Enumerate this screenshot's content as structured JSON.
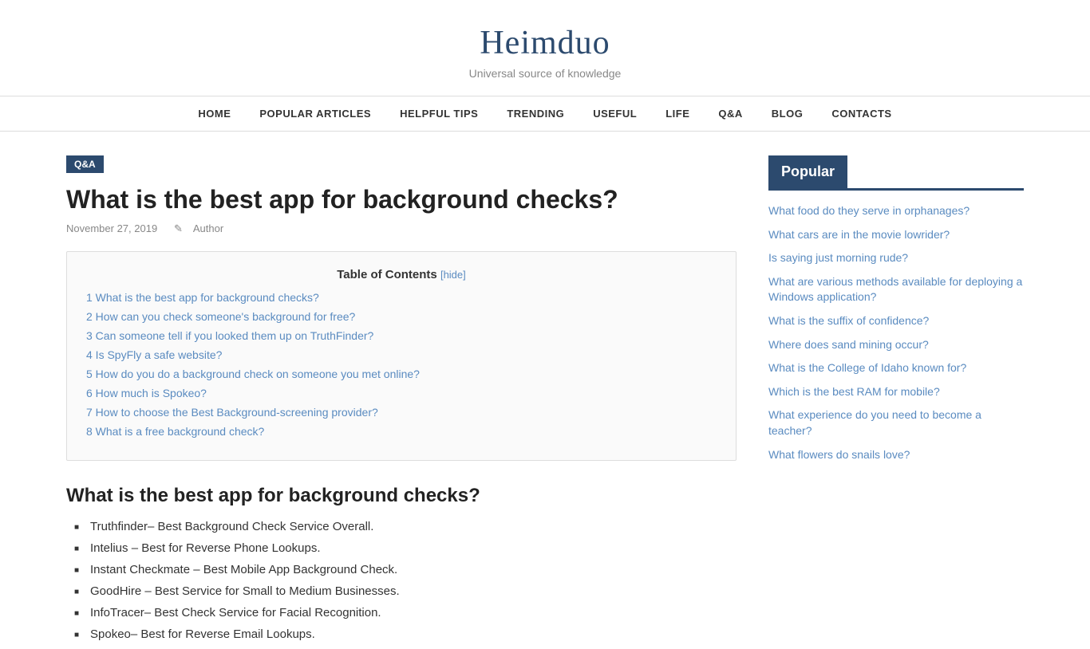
{
  "site": {
    "title": "Heimduo",
    "tagline": "Universal source of knowledge"
  },
  "nav": {
    "items": [
      {
        "label": "HOME",
        "href": "#"
      },
      {
        "label": "POPULAR ARTICLES",
        "href": "#"
      },
      {
        "label": "HELPFUL TIPS",
        "href": "#"
      },
      {
        "label": "TRENDING",
        "href": "#"
      },
      {
        "label": "USEFUL",
        "href": "#"
      },
      {
        "label": "LIFE",
        "href": "#"
      },
      {
        "label": "Q&A",
        "href": "#"
      },
      {
        "label": "BLOG",
        "href": "#"
      },
      {
        "label": "CONTACTS",
        "href": "#"
      }
    ]
  },
  "article": {
    "tag": "Q&A",
    "title": "What is the best app for background checks?",
    "date": "November 27, 2019",
    "author": "Author",
    "toc_title": "Table of Contents",
    "toc_hide": "[hide]",
    "toc_items": [
      {
        "number": "1",
        "label": "What is the best app for background checks?"
      },
      {
        "number": "2",
        "label": "How can you check someone's background for free?"
      },
      {
        "number": "3",
        "label": "Can someone tell if you looked them up on TruthFinder?"
      },
      {
        "number": "4",
        "label": "Is SpyFly a safe website?"
      },
      {
        "number": "5",
        "label": "How do you do a background check on someone you met online?"
      },
      {
        "number": "6",
        "label": "How much is Spokeo?"
      },
      {
        "number": "7",
        "label": "How to choose the Best Background-screening provider?"
      },
      {
        "number": "8",
        "label": "What is a free background check?"
      }
    ],
    "section1_heading": "What is the best app for background checks?",
    "bullets": [
      "Truthfinder– Best Background Check Service Overall.",
      "Intelius – Best for Reverse Phone Lookups.",
      "Instant Checkmate – Best Mobile App Background Check.",
      "GoodHire – Best Service for Small to Medium Businesses.",
      "InfoTracer– Best Check Service for Facial Recognition.",
      "Spokeo– Best for Reverse Email Lookups."
    ]
  },
  "sidebar": {
    "popular_title": "Popular",
    "links": [
      "What food do they serve in orphanages?",
      "What cars are in the movie lowrider?",
      "Is saying just morning rude?",
      "What are various methods available for deploying a Windows application?",
      "What is the suffix of confidence?",
      "Where does sand mining occur?",
      "What is the College of Idaho known for?",
      "Which is the best RAM for mobile?",
      "What experience do you need to become a teacher?",
      "What flowers do snails love?"
    ]
  }
}
